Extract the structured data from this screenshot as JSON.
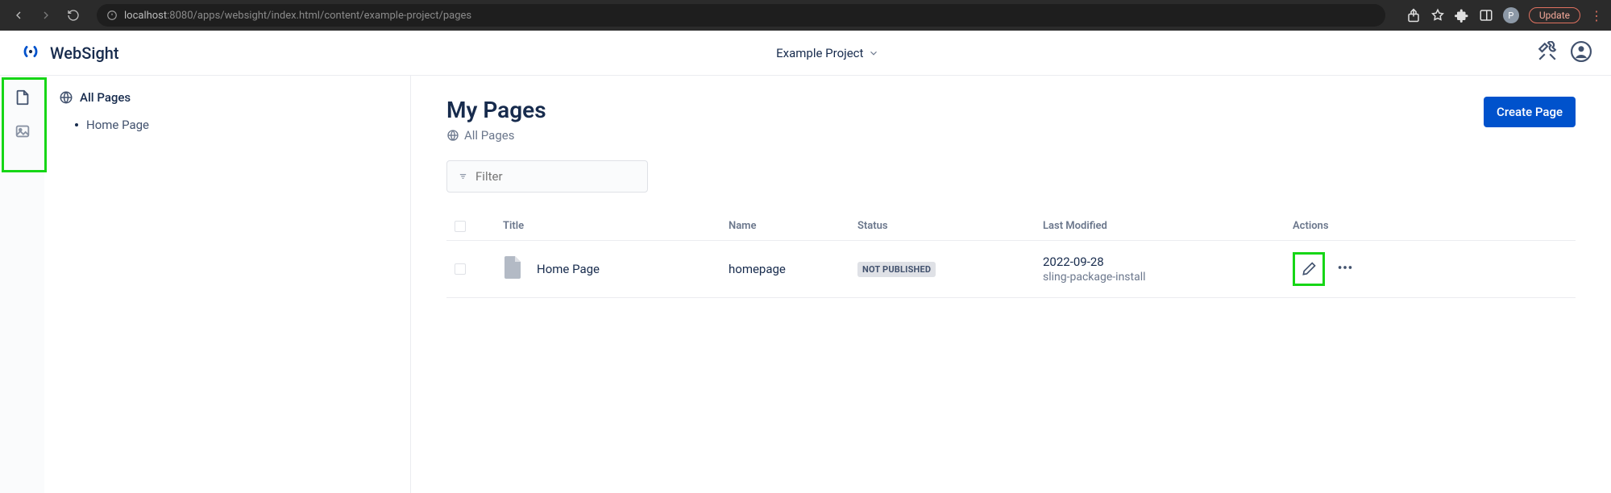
{
  "browser": {
    "url_prefix": "localhost",
    "url_rest": ":8080/apps/websight/index.html/content/example-project/pages",
    "avatar_letter": "P",
    "update_label": "Update"
  },
  "brand": {
    "name": "WebSight"
  },
  "header": {
    "project_name": "Example Project"
  },
  "sidebar": {
    "root_label": "All Pages",
    "items": [
      {
        "label": "Home Page"
      }
    ]
  },
  "main": {
    "title": "My Pages",
    "breadcrumb": "All Pages",
    "create_button": "Create Page",
    "filter_placeholder": "Filter"
  },
  "table": {
    "columns": {
      "title": "Title",
      "name": "Name",
      "status": "Status",
      "modified": "Last Modified",
      "actions": "Actions"
    },
    "rows": [
      {
        "title": "Home Page",
        "name": "homepage",
        "status": "NOT PUBLISHED",
        "modified_date": "2022-09-28",
        "modified_by": "sling-package-install"
      }
    ]
  }
}
